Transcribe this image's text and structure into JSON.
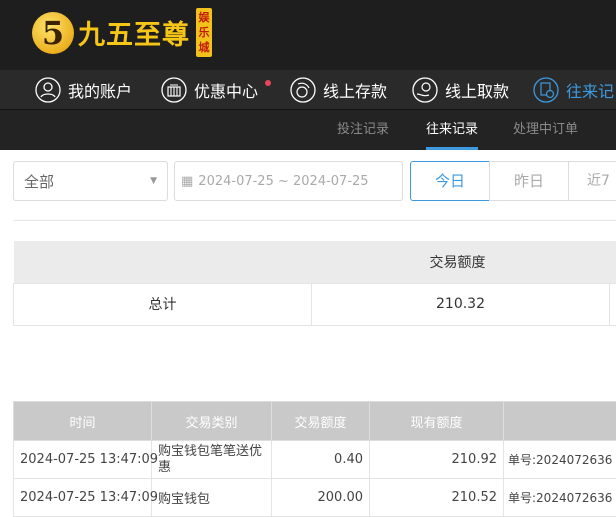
{
  "brand": {
    "name": "九五至尊",
    "sub": "娱乐城",
    "logo_digit": "5"
  },
  "nav": [
    {
      "label": "我的账户",
      "icon": "user-icon"
    },
    {
      "label": "优惠中心",
      "icon": "gift-icon",
      "badge": true
    },
    {
      "label": "线上存款",
      "icon": "deposit-icon"
    },
    {
      "label": "线上取款",
      "icon": "withdraw-icon"
    },
    {
      "label": "往来记",
      "icon": "record-icon",
      "active": true
    }
  ],
  "subnav": [
    {
      "label": "投注记录"
    },
    {
      "label": "往来记录",
      "active": true
    },
    {
      "label": "处理中订单"
    }
  ],
  "filters": {
    "type_select": "全部",
    "date_range": "2024-07-25 ~ 2024-07-25",
    "quick": [
      "今日",
      "昨日",
      "近7"
    ],
    "active_quick": "今日"
  },
  "summary": {
    "header": "交易额度",
    "label": "总计",
    "value": "210.32"
  },
  "details": {
    "columns": [
      "时间",
      "交易类别",
      "交易额度",
      "现有额度",
      ""
    ],
    "rows": [
      {
        "time": "2024-07-25 13:47:09",
        "type": "购宝钱包笔笔送优惠",
        "amount": "0.40",
        "balance": "210.92",
        "note": "单号:2024072636"
      },
      {
        "time": "2024-07-25 13:47:09",
        "type": "购宝钱包",
        "amount": "200.00",
        "balance": "210.52",
        "note": "单号:2024072636"
      }
    ]
  },
  "colors": {
    "accent": "#3d9ae0",
    "badge": "#e8465a",
    "header_bg": "#1e1e1e"
  }
}
